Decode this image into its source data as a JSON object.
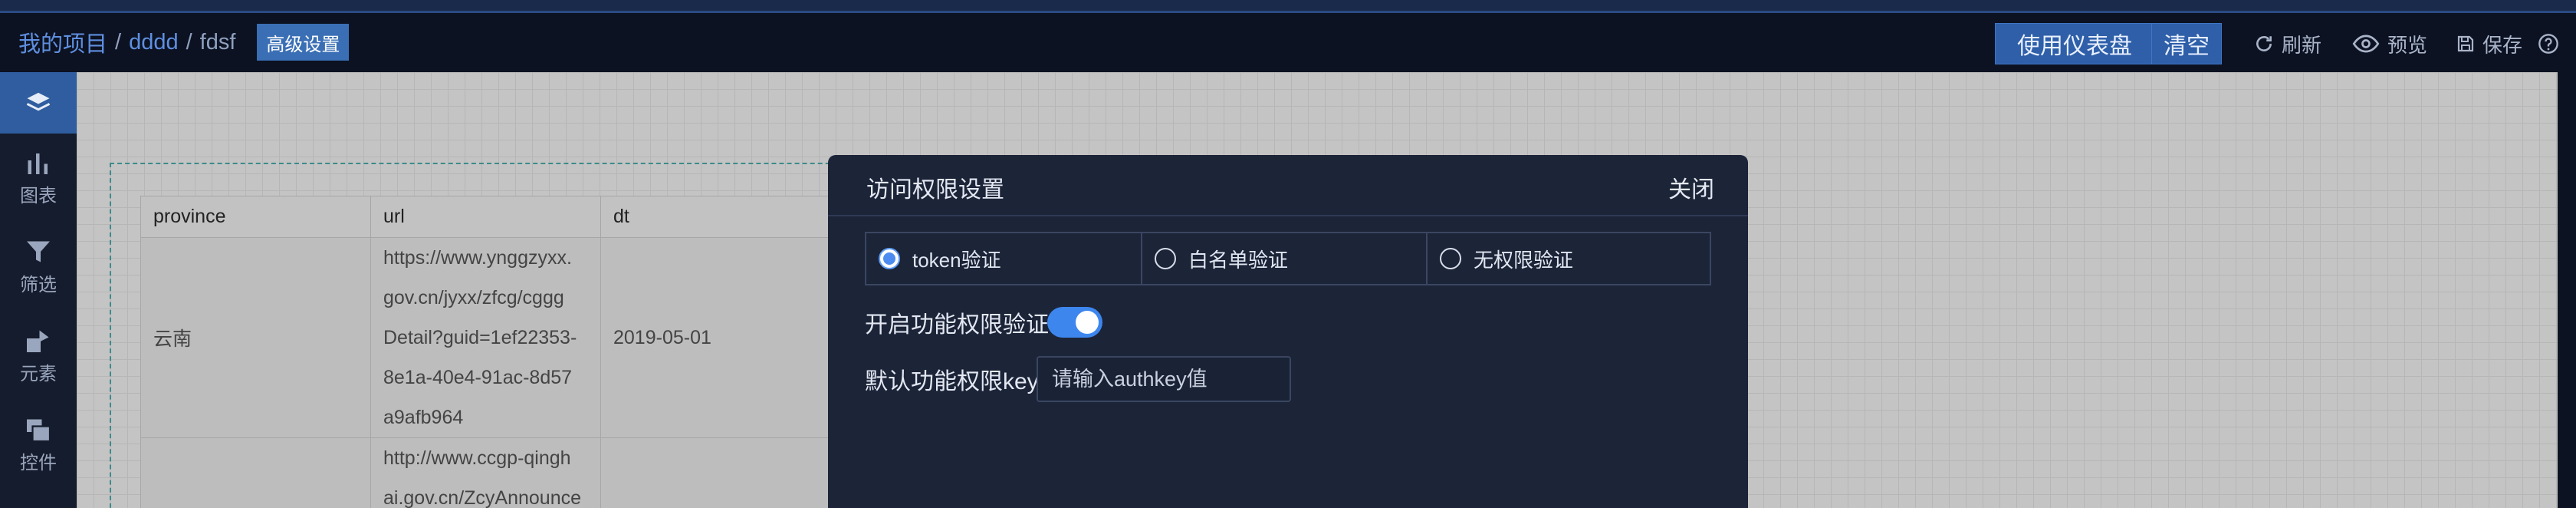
{
  "header": {
    "breadcrumb": [
      "我的项目",
      "dddd",
      "fdsf"
    ],
    "separator": "/",
    "advanced_btn": "高级设置",
    "dashboard_btn": "使用仪表盘",
    "clear_btn": "清空",
    "refresh": "刷新",
    "preview": "预览",
    "save": "保存"
  },
  "sidebar": {
    "items": [
      {
        "label": "图表",
        "icon": "bar-chart-icon"
      },
      {
        "label": "筛选",
        "icon": "filter-icon"
      },
      {
        "label": "元素",
        "icon": "shapes-icon"
      },
      {
        "label": "控件",
        "icon": "widgets-icon"
      }
    ]
  },
  "table": {
    "columns": [
      "province",
      "url",
      "dt"
    ],
    "rows": [
      {
        "province": "云南",
        "url_lines": [
          "https://www.ynggzyxx.",
          "gov.cn/jyxx/zfcg/cggg",
          "Detail?guid=1ef22353-",
          "8e1a-40e4-91ac-8d57",
          "a9afb964"
        ],
        "dt": "2019-05-01"
      },
      {
        "province": "",
        "url_lines": [
          "http://www.ccgp-qingh",
          "ai.gov.cn/ZcyAnnounce"
        ],
        "dt": ""
      }
    ]
  },
  "modal": {
    "title": "访问权限设置",
    "close": "关闭",
    "options": [
      "token验证",
      "白名单验证",
      "无权限验证"
    ],
    "selected_option": "token验证",
    "toggle_label": "开启功能权限验证",
    "toggle_on": true,
    "key_label": "默认功能权限key",
    "key_placeholder": "请输入authkey值"
  },
  "colors": {
    "accent": "#3d86ee",
    "header_bg": "#0c1221",
    "modal_bg": "#1c2438"
  }
}
